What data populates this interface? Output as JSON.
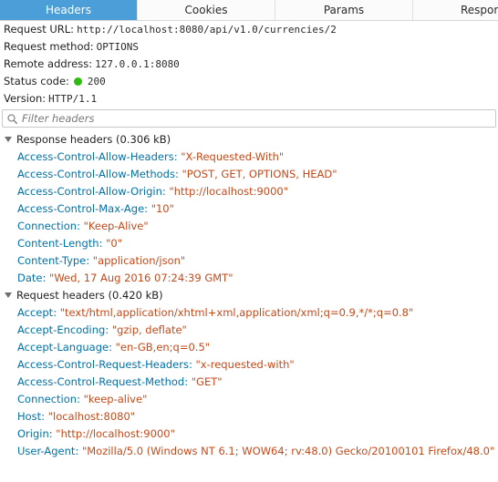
{
  "tabs": [
    {
      "label": "Headers",
      "active": true
    },
    {
      "label": "Cookies",
      "active": false
    },
    {
      "label": "Params",
      "active": false
    },
    {
      "label": "Respons",
      "active": false
    }
  ],
  "summary": {
    "request_url_label": "Request URL:",
    "request_url": "http://localhost:8080/api/v1.0/currencies/2",
    "request_method_label": "Request method:",
    "request_method": "OPTIONS",
    "remote_address_label": "Remote address:",
    "remote_address": "127.0.0.1:8080",
    "status_code_label": "Status code:",
    "status_code": "200",
    "status_color": "#2cbb0f",
    "version_label": "Version:",
    "version": "HTTP/1.1"
  },
  "filter": {
    "placeholder": "Filter headers",
    "icon": "search-icon"
  },
  "response_section": {
    "title": "Response headers (0.306 kB)",
    "headers": [
      {
        "name": "Access-Control-Allow-Headers",
        "value": "\"X-Requested-With\""
      },
      {
        "name": "Access-Control-Allow-Methods",
        "value": "\"POST, GET, OPTIONS, HEAD\""
      },
      {
        "name": "Access-Control-Allow-Origin",
        "value": "\"http://localhost:9000\""
      },
      {
        "name": "Access-Control-Max-Age",
        "value": "\"10\""
      },
      {
        "name": "Connection",
        "value": "\"Keep-Alive\""
      },
      {
        "name": "Content-Length",
        "value": "\"0\""
      },
      {
        "name": "Content-Type",
        "value": "\"application/json\""
      },
      {
        "name": "Date",
        "value": "\"Wed, 17 Aug 2016 07:24:39 GMT\""
      }
    ]
  },
  "request_section": {
    "title": "Request headers (0.420 kB)",
    "headers": [
      {
        "name": "Accept",
        "value": "\"text/html,application/xhtml+xml,application/xml;q=0.9,*/*;q=0.8\""
      },
      {
        "name": "Accept-Encoding",
        "value": "\"gzip, deflate\""
      },
      {
        "name": "Accept-Language",
        "value": "\"en-GB,en;q=0.5\""
      },
      {
        "name": "Access-Control-Request-Headers",
        "value": "\"x-requested-with\""
      },
      {
        "name": "Access-Control-Request-Method",
        "value": "\"GET\""
      },
      {
        "name": "Connection",
        "value": "\"keep-alive\""
      },
      {
        "name": "Host",
        "value": "\"localhost:8080\""
      },
      {
        "name": "Origin",
        "value": "\"http://localhost:9000\""
      },
      {
        "name": "User-Agent",
        "value": "\"Mozilla/5.0 (Windows NT 6.1; WOW64; rv:48.0) Gecko/20100101 Firefox/48.0\""
      }
    ]
  },
  "colors": {
    "accent": "#4c9ed9",
    "header_name": "#0072a8",
    "header_value": "#c44a1a"
  }
}
